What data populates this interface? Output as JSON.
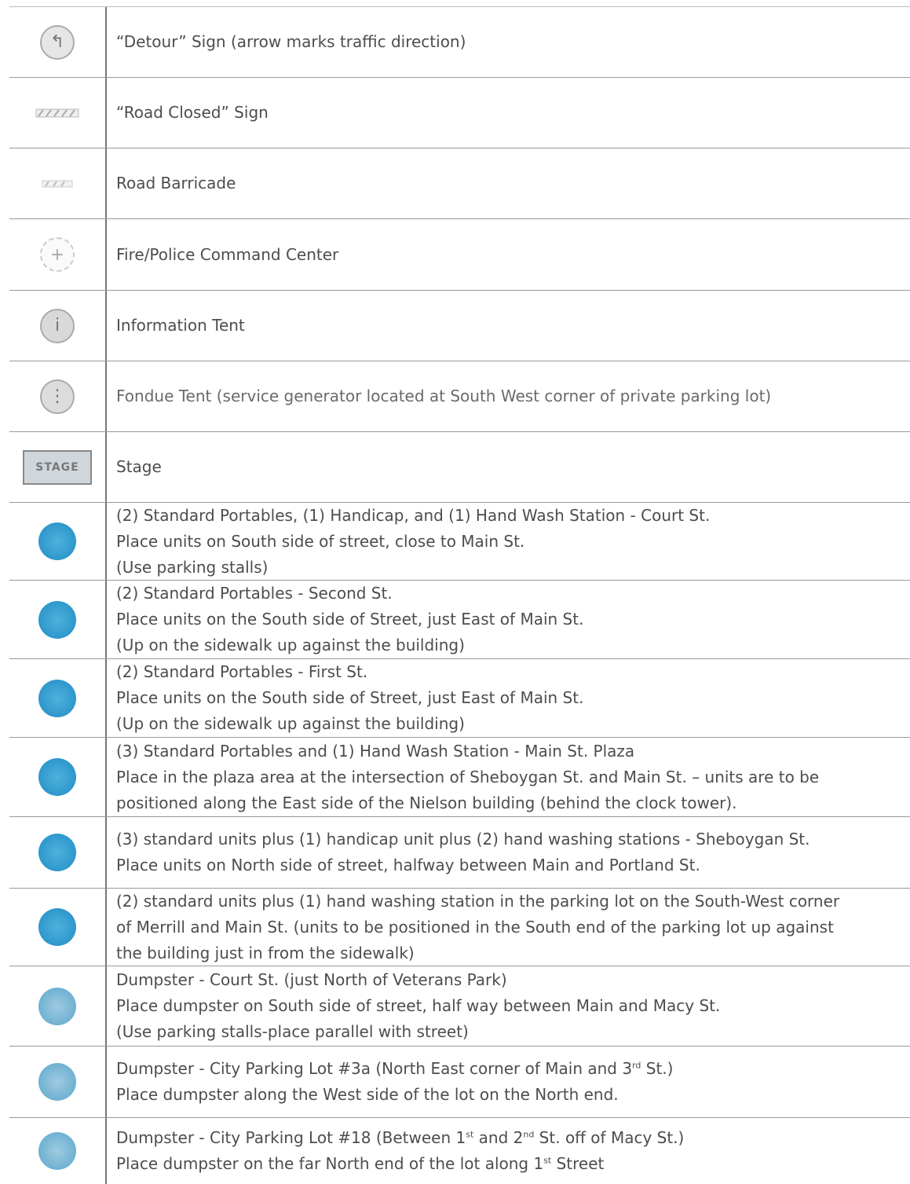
{
  "rows": [
    {
      "icon": "detour-sign-icon",
      "lines": [
        "“Detour” Sign (arrow marks traffic direction)"
      ]
    },
    {
      "icon": "road-closed-sign-icon",
      "lines": [
        "“Road Closed” Sign"
      ]
    },
    {
      "icon": "road-barricade-icon",
      "lines": [
        "Road Barricade"
      ]
    },
    {
      "icon": "command-center-icon",
      "lines": [
        "Fire/Police Command Center"
      ]
    },
    {
      "icon": "information-tent-icon",
      "lines": [
        "Information Tent"
      ]
    },
    {
      "icon": "fondue-tent-icon",
      "lines": [
        "Fondue Tent (service generator located at South West corner of private parking lot)"
      ]
    },
    {
      "icon": "stage-icon",
      "icon_text": "STAGE",
      "lines": [
        "Stage"
      ]
    },
    {
      "icon": "portable-toilet-icon",
      "lines": [
        "(2) Standard Portables, (1) Handicap, and (1) Hand Wash Station - Court St.",
        "Place units on South side of street, close to Main St.",
        "(Use parking stalls)"
      ]
    },
    {
      "icon": "portable-toilet-icon",
      "lines": [
        "(2) Standard Portables - Second St.",
        "Place units on the South side of Street, just East of Main St.",
        "(Up on the sidewalk up against the building)"
      ]
    },
    {
      "icon": "portable-toilet-icon",
      "lines": [
        "(2) Standard Portables - First St.",
        "Place units on the South side of Street, just East of Main St.",
        "(Up on the sidewalk up against the building)"
      ]
    },
    {
      "icon": "portable-toilet-icon",
      "lines": [
        "(3) Standard Portables and (1) Hand Wash Station - Main St. Plaza",
        "Place in the plaza area at the intersection of Sheboygan St. and Main St. – units are to be",
        "positioned along the East side of the Nielson building (behind the clock tower)."
      ]
    },
    {
      "icon": "portable-toilet-icon",
      "lines": [
        "(3) standard units plus (1) handicap unit plus (2) hand washing stations - Sheboygan St.",
        "Place units on North side of street, halfway between Main and Portland St."
      ]
    },
    {
      "icon": "portable-toilet-icon",
      "lines": [
        "(2) standard units plus (1) hand washing station in the parking lot on the South-West corner",
        "of Merrill and Main St. (units to be positioned in the South end of the parking lot up against",
        "the building just in from the sidewalk)"
      ]
    },
    {
      "icon": "dumpster-icon",
      "lines": [
        "Dumpster - Court St. (just North of Veterans Park)",
        "Place dumpster on South side of street, half way between Main and Macy St.",
        "(Use parking stalls-place parallel with street)"
      ]
    },
    {
      "icon": "dumpster-icon",
      "lines": [
        "Dumpster - City Parking Lot #3a (North East corner of Main and 3rd St.)",
        "Place dumpster along the West side of the lot on the North end."
      ]
    },
    {
      "icon": "dumpster-icon",
      "lines": [
        "Dumpster - City Parking Lot #18 (Between 1st and 2nd St. off of Macy St.)",
        "Place dumpster on the far North end of the lot along 1st Street"
      ]
    }
  ]
}
